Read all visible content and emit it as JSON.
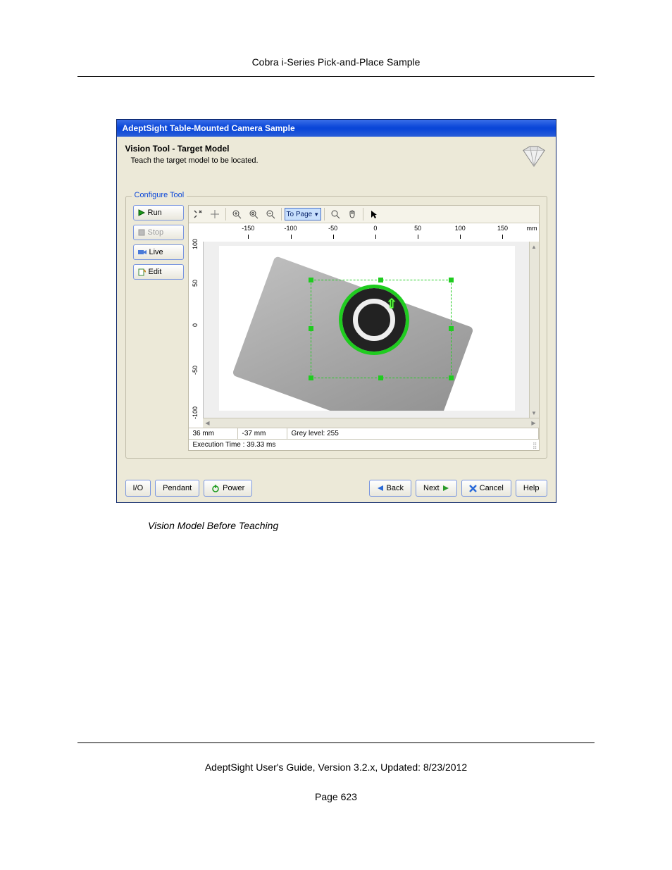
{
  "doc": {
    "header": "Cobra i-Series Pick-and-Place Sample",
    "caption": "Vision Model Before Teaching",
    "footer_line": "AdeptSight User's Guide,  Version 3.2.x, Updated: 8/23/2012",
    "page_num": "Page 623"
  },
  "app": {
    "title": "AdeptSight Table-Mounted Camera Sample",
    "tool_title": "Vision Tool - Target Model",
    "tool_sub": "Teach the target model to be located.",
    "fieldset": "Configure Tool",
    "side_buttons": {
      "run": "Run",
      "stop": "Stop",
      "live": "Live",
      "edit": "Edit"
    },
    "toolbar": {
      "to_page": "To Page"
    },
    "ruler_x": {
      "ticks": [
        "-150",
        "-100",
        "-50",
        "0",
        "50",
        "100",
        "150"
      ],
      "unit": "mm"
    },
    "ruler_y": {
      "ticks": [
        "100",
        "50",
        "0",
        "-50",
        "-100"
      ]
    },
    "status": {
      "x": "36 mm",
      "y": "-37 mm",
      "grey": "Grey level: 255",
      "exec": "Execution Time : 39.33 ms"
    },
    "footer": {
      "io": "I/O",
      "pendant": "Pendant",
      "power": "Power",
      "back": "Back",
      "next": "Next",
      "cancel": "Cancel",
      "help": "Help"
    }
  }
}
